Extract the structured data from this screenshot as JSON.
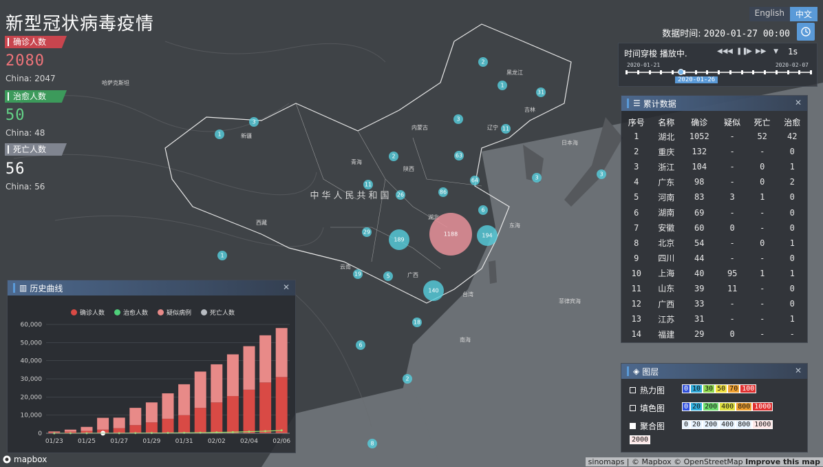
{
  "header": {
    "title": "新型冠状病毒疫情"
  },
  "stats": {
    "confirmed": {
      "label": "确诊人数",
      "value": "2080",
      "china": "China: 2047"
    },
    "cured": {
      "label": "治愈人数",
      "value": "50",
      "china": "China: 48"
    },
    "death": {
      "label": "死亡人数",
      "value": "56",
      "china": "China: 56"
    }
  },
  "lang": {
    "en": "English",
    "zh": "中文"
  },
  "time": {
    "label": "数据时间:",
    "value": "2020-01-27 00:00"
  },
  "player": {
    "title": "时间穿梭 播放中.",
    "speed": "1s",
    "start": "2020-01-21",
    "end": "2020-02-07",
    "current": "2020-01-26"
  },
  "cumulative": {
    "title": "累计数据",
    "headers": [
      "序号",
      "名称",
      "确诊",
      "疑似",
      "死亡",
      "治愈"
    ],
    "rows": [
      [
        "1",
        "湖北",
        "1052",
        "-",
        "52",
        "42"
      ],
      [
        "2",
        "重庆",
        "132",
        "-",
        "-",
        "0"
      ],
      [
        "3",
        "浙江",
        "104",
        "-",
        "0",
        "1"
      ],
      [
        "4",
        "广东",
        "98",
        "-",
        "0",
        "2"
      ],
      [
        "5",
        "河南",
        "83",
        "3",
        "1",
        "0"
      ],
      [
        "6",
        "湖南",
        "69",
        "-",
        "-",
        "0"
      ],
      [
        "7",
        "安徽",
        "60",
        "0",
        "-",
        "0"
      ],
      [
        "8",
        "北京",
        "54",
        "-",
        "0",
        "1"
      ],
      [
        "9",
        "四川",
        "44",
        "-",
        "-",
        "0"
      ],
      [
        "10",
        "上海",
        "40",
        "95",
        "1",
        "1"
      ],
      [
        "11",
        "山东",
        "39",
        "11",
        "-",
        "0"
      ],
      [
        "12",
        "广西",
        "33",
        "-",
        "-",
        "0"
      ],
      [
        "13",
        "江苏",
        "31",
        "-",
        "-",
        "1"
      ],
      [
        "14",
        "福建",
        "29",
        "0",
        "-",
        "-"
      ]
    ]
  },
  "history": {
    "title": "历史曲线",
    "legend": [
      "确诊人数",
      "治愈人数",
      "疑似病例",
      "死亡人数"
    ],
    "legend_colors": [
      "#d94a45",
      "#4fd07a",
      "#e88a88",
      "#b8bcc2"
    ]
  },
  "chart_data": {
    "type": "bar",
    "categories": [
      "01/23",
      "01/24",
      "01/25",
      "01/26",
      "01/27",
      "01/28",
      "01/29",
      "01/30",
      "01/31",
      "02/01",
      "02/02",
      "02/03",
      "02/04",
      "02/05",
      "02/06"
    ],
    "xticks": [
      "01/23",
      "01/25",
      "01/27",
      "01/29",
      "01/31",
      "02/02",
      "02/04",
      "02/06"
    ],
    "series": [
      {
        "name": "确诊人数",
        "values": [
          600,
          900,
          1300,
          2000,
          2800,
          4500,
          6000,
          8000,
          10000,
          14000,
          17000,
          20500,
          24000,
          28000,
          31000
        ]
      },
      {
        "name": "疑似病例",
        "values": [
          400,
          1100,
          2200,
          6500,
          5800,
          9500,
          11000,
          14000,
          17000,
          20000,
          21000,
          23000,
          24000,
          26000,
          27000
        ]
      },
      {
        "name": "治愈人数",
        "values": [
          20,
          30,
          40,
          50,
          60,
          100,
          130,
          170,
          240,
          300,
          480,
          630,
          890,
          1150,
          1550
        ]
      }
    ],
    "ylim": [
      0,
      60000
    ],
    "yticks": [
      "0",
      "10,000",
      "20,000",
      "30,000",
      "40,000",
      "50,000",
      "60,000"
    ]
  },
  "layers": {
    "title": "图层",
    "items": [
      {
        "label": "热力图",
        "scale": [
          "0",
          "10",
          "30",
          "50",
          "70",
          "100"
        ]
      },
      {
        "label": "填色图",
        "scale": [
          "0",
          "20",
          "200",
          "400",
          "800",
          "1000"
        ]
      },
      {
        "label": "聚合图",
        "scale": [
          "0",
          "20",
          "200",
          "400",
          "800",
          "1000"
        ]
      }
    ],
    "extra": "2000"
  },
  "map": {
    "country_label": "中华人民共和国",
    "bubbles": [
      {
        "v": "1188"
      },
      {
        "v": "194"
      },
      {
        "v": "189"
      },
      {
        "v": "140"
      },
      {
        "v": "63"
      },
      {
        "v": "64"
      },
      {
        "v": "86"
      },
      {
        "v": "26"
      },
      {
        "v": "31"
      },
      {
        "v": "29"
      },
      {
        "v": "19"
      },
      {
        "v": "18"
      },
      {
        "v": "11"
      },
      {
        "v": "11"
      },
      {
        "v": "8"
      },
      {
        "v": "6"
      },
      {
        "v": "6"
      },
      {
        "v": "5"
      },
      {
        "v": "3"
      },
      {
        "v": "3"
      },
      {
        "v": "3"
      },
      {
        "v": "3"
      },
      {
        "v": "2"
      },
      {
        "v": "2"
      },
      {
        "v": "2"
      },
      {
        "v": "1"
      },
      {
        "v": "1"
      },
      {
        "v": "1"
      }
    ]
  },
  "footer": {
    "logo": "mapbox",
    "attribution": "sinomaps | © Mapbox © OpenStreetMap",
    "improve": "Improve this map"
  }
}
